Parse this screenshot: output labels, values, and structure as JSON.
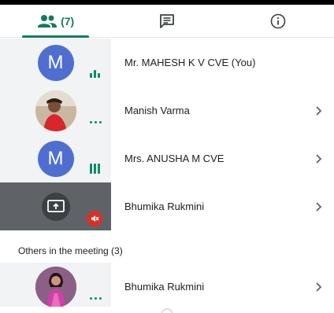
{
  "tabs": {
    "people_count": "(7)",
    "people_icon": "people-icon",
    "chat_icon": "chat-icon",
    "info_icon": "info-icon",
    "accent": "#137a60"
  },
  "participants": [
    {
      "name": "Mr. MAHESH K V CVE (You)",
      "initial": "M",
      "status": "speaking-bars"
    },
    {
      "name": "Manish Varma",
      "status": "dots"
    },
    {
      "name": "Mrs. ANUSHA M CVE",
      "initial": "M",
      "status": "speaking-bars"
    },
    {
      "name": "Bhumika Rukmini",
      "status": "presenting-muted"
    }
  ],
  "others": {
    "title": "Others in the meeting (3)",
    "items": [
      {
        "name": "Bhumika Rukmini",
        "status": "dots"
      }
    ]
  }
}
